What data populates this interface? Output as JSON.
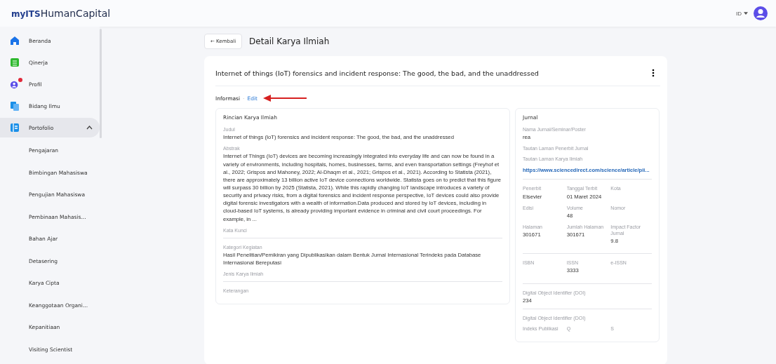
{
  "header": {
    "logo_prefix": "myITS",
    "logo_name": "HumanCapital",
    "language": "ID"
  },
  "sidebar": {
    "items": [
      {
        "label": "Beranda",
        "kind": "home",
        "selected": false,
        "notification": false
      },
      {
        "label": "Qinerja",
        "kind": "sheet",
        "selected": false,
        "notification": false
      },
      {
        "label": "Profil",
        "kind": "user",
        "selected": false,
        "notification": true
      },
      {
        "label": "Bidang Ilmu",
        "kind": "docs",
        "selected": false,
        "notification": false
      },
      {
        "label": "Portofolio",
        "kind": "folder",
        "selected": true,
        "notification": false,
        "expanded": true,
        "children": [
          {
            "label": "Pengajaran"
          },
          {
            "label": "Bimbingan Mahasiswa"
          },
          {
            "label": "Pengujian Mahasiswa"
          },
          {
            "label": "Pembinaan Mahasis..."
          },
          {
            "label": "Bahan Ajar"
          },
          {
            "label": "Detasering"
          },
          {
            "label": "Karya Cipta"
          },
          {
            "label": "Keanggotaan Organi..."
          },
          {
            "label": "Kepanitiaan"
          },
          {
            "label": "Visiting Scientist"
          }
        ]
      }
    ]
  },
  "page": {
    "back_button": "← Kembali",
    "title": "Detail Karya Ilmiah"
  },
  "card": {
    "title": "Internet of things (IoT) forensics and incident response: The good, the bad, and the unaddressed",
    "section_label": "Informasi",
    "separator": "·",
    "edit_link": "Edit",
    "details": {
      "title": "Rincian Karya Ilmiah",
      "groups": [
        [
          {
            "label": "Judul",
            "value": "Internet of things (IoT) forensics and incident response: The good, the bad, and the unaddressed"
          },
          {
            "label": "Abstrak",
            "value": "Internet of Things (IoT) devices are becoming increasingly integrated into everyday life and can now be found in a variety of environments, including hospitals, homes, businesses, farms, and even transportation settings (Freyhof et al., 2022; Grispos and Mahoney, 2022; Al-Dhaqm et al., 2021; Grispos et al., 2021). According to Statista (2021), there are approximately 13 billion active IoT device connections worldwide. Statista goes on to predict that this figure will surpass 30 billion by 2025 (Statista, 2021). While this rapidly changing IoT landscape introduces a variety of security and privacy risks, from a digital forensics and incident response perspective, IoT devices could also provide digital forensic investigators with a wealth of information.Data produced and stored by IoT devices, including in cloud-based IoT systems, is already providing important evidence in criminal and civil court proceedings. For example, in ..."
          },
          {
            "label": "Kata Kunci"
          }
        ],
        [
          {
            "label": "Kategori Kegiatan",
            "value": "Hasil Penelitian/Pemikiran yang Dipublikasikan dalam Bentuk Jurnal Internasional Terindeks pada Database Internasional Bereputasi"
          },
          {
            "label": "Jenis Karya Ilmiah"
          }
        ],
        [
          {
            "label": "Keterangan"
          }
        ]
      ]
    },
    "journal": {
      "title": "Jurnal",
      "sections": [
        {
          "kind": "list",
          "fields": [
            {
              "label": "Nama Jurnal/Seminar/Poster",
              "value": "rea"
            },
            {
              "label": "Tautan Laman Penerbit Jurnal"
            },
            {
              "label": "Tautan Laman Karya Ilmiah",
              "value": "https://www.sciencedirect.com/science/article/pii...",
              "kind": "link"
            }
          ]
        },
        {
          "kind": "grid",
          "fields": [
            {
              "label": "Penerbit",
              "value": "Elsevier"
            },
            {
              "label": "Tanggal Terbit",
              "value": "01 Maret 2024"
            },
            {
              "label": "Kota"
            },
            {
              "label": "Edisi"
            },
            {
              "label": "Volume",
              "value": "48"
            },
            {
              "label": "Nomor"
            },
            {
              "label": "Halaman",
              "value": "301671"
            },
            {
              "label": "Jumlah Halaman",
              "value": "301671"
            },
            {
              "label": "Impact Factor Jurnal",
              "value": "9.8"
            }
          ]
        },
        {
          "kind": "grid",
          "fields": [
            {
              "label": "ISBN"
            },
            {
              "label": "ISSN",
              "value": "3333"
            },
            {
              "label": "e-ISSN"
            }
          ]
        },
        {
          "kind": "list",
          "fields": [
            {
              "label": "Digital Object Identifier (DOI)",
              "value": "234"
            }
          ]
        },
        {
          "kind": "list",
          "fields": [
            {
              "label": "Digital Object Identifier (DOI)"
            }
          ]
        },
        {
          "kind": "grid",
          "fields": [
            {
              "label": "Indeks Publikasi"
            },
            {
              "label": "Q"
            },
            {
              "label": "S"
            }
          ]
        }
      ]
    }
  }
}
